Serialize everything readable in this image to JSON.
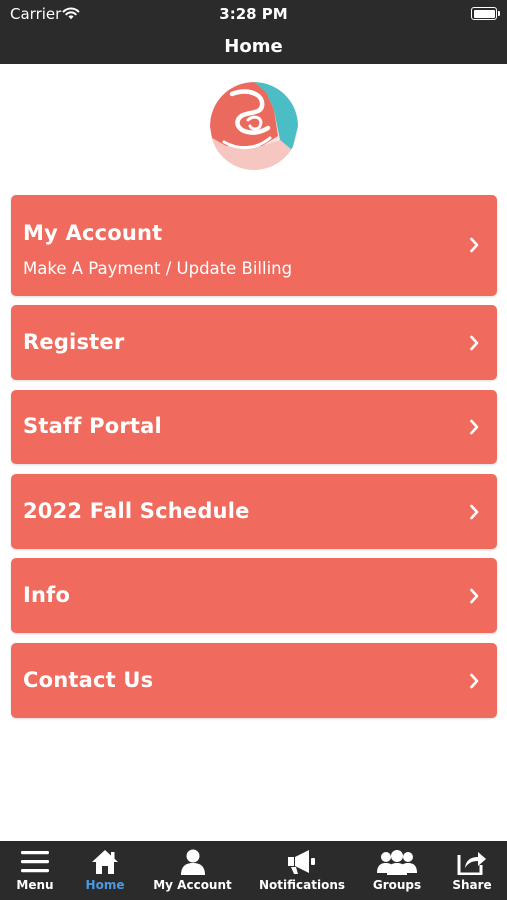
{
  "status_bar": {
    "carrier": "Carrier",
    "time": "3:28 PM"
  },
  "header": {
    "title": "Home"
  },
  "colors": {
    "header_bg": "#2b2b2b",
    "button_bg": "#f06b5e",
    "active_tab": "#4a9ae0",
    "logo_coral": "#ea6a5d",
    "logo_teal": "#4bbdc4",
    "logo_pink": "#f6c6c1"
  },
  "menu": [
    {
      "title": "My Account",
      "subtitle": "Make A Payment / Update Billing",
      "icon": "chevron-right-icon"
    },
    {
      "title": "Register",
      "icon": "chevron-right-icon"
    },
    {
      "title": "Staff Portal",
      "icon": "chevron-right-icon"
    },
    {
      "title": "2022 Fall Schedule",
      "icon": "chevron-right-icon"
    },
    {
      "title": "Info",
      "icon": "chevron-right-icon"
    },
    {
      "title": "Contact Us",
      "icon": "chevron-right-icon"
    }
  ],
  "tabs": [
    {
      "label": "Menu",
      "icon": "hamburger-menu-icon"
    },
    {
      "label": "Home",
      "icon": "home-icon",
      "active": true
    },
    {
      "label": "My Account",
      "icon": "user-icon"
    },
    {
      "label": "Notifications",
      "icon": "megaphone-icon"
    },
    {
      "label": "Groups",
      "icon": "group-icon"
    },
    {
      "label": "Share",
      "icon": "share-icon"
    }
  ]
}
